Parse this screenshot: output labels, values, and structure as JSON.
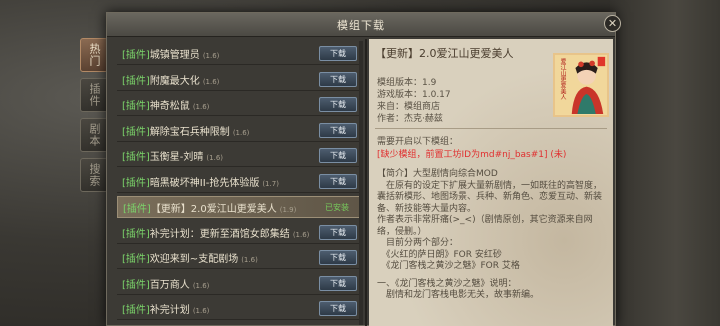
{
  "dialog": {
    "title": "模组下载",
    "close_icon": "close-icon"
  },
  "side_tabs": [
    {
      "label": "热门",
      "active": true
    },
    {
      "label": "插件",
      "active": false
    },
    {
      "label": "剧本",
      "active": false
    },
    {
      "label": "搜索",
      "active": false
    }
  ],
  "list": {
    "download_label": "下载",
    "installed_label": "已安装",
    "rows": [
      {
        "tag": "[插件]",
        "name": "城镇管理员",
        "version": "(1.6)",
        "installed": false
      },
      {
        "tag": "[插件]",
        "name": "附魔最大化",
        "version": "(1.6)",
        "installed": false
      },
      {
        "tag": "[插件]",
        "name": "神奇松鼠",
        "version": "(1.6)",
        "installed": false
      },
      {
        "tag": "[插件]",
        "name": "解除宝石兵种限制",
        "version": "(1.6)",
        "installed": false
      },
      {
        "tag": "[插件]",
        "name": "玉衡星-刘晴",
        "version": "(1.6)",
        "installed": false
      },
      {
        "tag": "[插件]",
        "name": "暗黑破坏神II-抢先体验版",
        "version": "(1.7)",
        "installed": false
      },
      {
        "tag": "[插件]",
        "name": "【更新】2.0爱江山更爱美人",
        "version": "(1.9)",
        "installed": true,
        "selected": true
      },
      {
        "tag": "[插件]",
        "name": "补完计划：更新至酒馆女郎集结",
        "version": "(1.6)",
        "installed": false
      },
      {
        "tag": "[插件]",
        "name": "欢迎来到~支配剧场",
        "version": "(1.6)",
        "installed": false
      },
      {
        "tag": "[插件]",
        "name": "百万商人",
        "version": "(1.6)",
        "installed": false
      },
      {
        "tag": "[插件]",
        "name": "补完计划",
        "version": "(1.6)",
        "installed": false
      }
    ]
  },
  "detail": {
    "title": "【更新】2.0爱江山更爱美人",
    "module_version": "模组版本：1.9",
    "game_version": "游戏版本：1.0.17",
    "source": "来自：模组商店",
    "author": "作者：杰克·赫兹",
    "requires_label": "需要开启以下模组：",
    "requires_value": "[缺少模组，前置工坊ID为md#nj_bas#1] (未)",
    "thumbnail_caption": "爱江山更爱美人",
    "body": [
      "【简介】大型剧情向综合MOD",
      "　在原有的设定下扩展大量新剧情，一如既往的高智度，囊括新模形、地图场景、兵种、新角色、恋爱互动、新装备、新技能等大量内容。",
      "作者表示非常肝痛(>_<)（剧情原创，其它资源来自网络，侵删。）",
      "　目前分两个部分：",
      "　《火红的萨日朗》FOR 安红砂",
      "　《龙门客栈之黄沙之魅》FOR 艾格",
      "",
      "一、《龙门客栈之黄沙之魅》说明：",
      "　剧情和龙门客栈电影无关，故事新编。"
    ]
  }
}
